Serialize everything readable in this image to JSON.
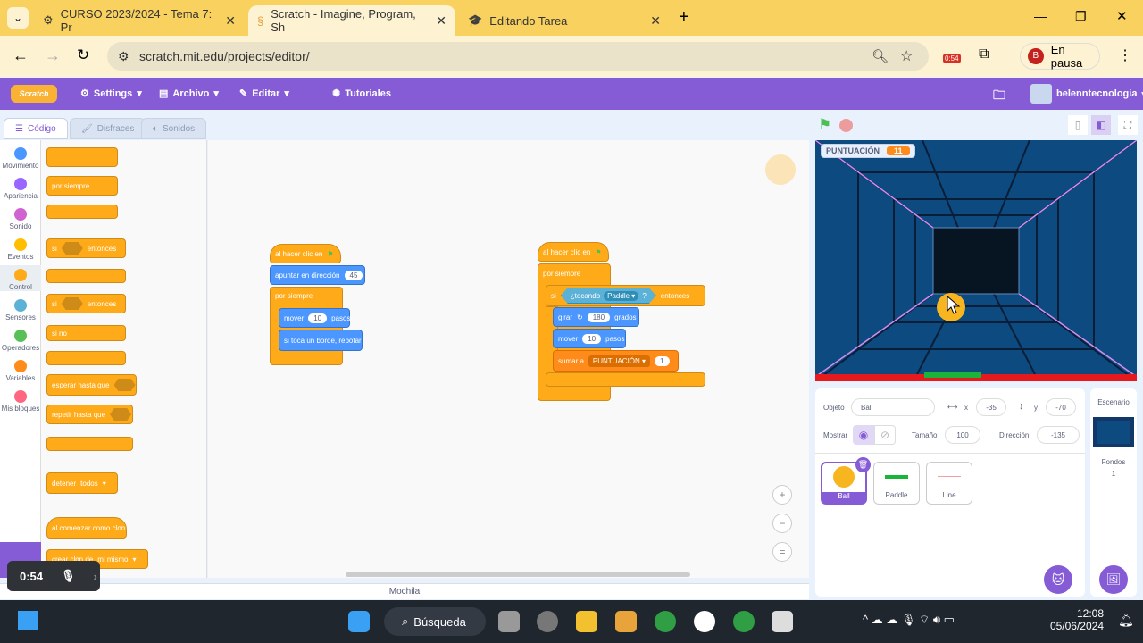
{
  "browser": {
    "tabs": [
      {
        "label": "CURSO 2023/2024 - Tema 7: Pr"
      },
      {
        "label": "Scratch - Imagine, Program, Sh"
      },
      {
        "label": "Editando Tarea"
      }
    ],
    "url": "scratch.mit.edu/projects/editor/",
    "timer_badge": "0:54",
    "profile_initial": "B",
    "profile_label": "En pausa"
  },
  "menubar": {
    "logo": "Scratch",
    "settings": "Settings",
    "file": "Archivo",
    "edit": "Editar",
    "tutorials": "Tutoriales",
    "user": "belenntecnologia"
  },
  "editor_tabs": {
    "code": "Código",
    "costumes": "Disfraces",
    "sounds": "Sonidos"
  },
  "categories": [
    {
      "label": "Movimiento",
      "color": "#4c97ff"
    },
    {
      "label": "Apariencia",
      "color": "#9966ff"
    },
    {
      "label": "Sonido",
      "color": "#cf63cf"
    },
    {
      "label": "Eventos",
      "color": "#ffbf00"
    },
    {
      "label": "Control",
      "color": "#ffab19"
    },
    {
      "label": "Sensores",
      "color": "#5cb1d6"
    },
    {
      "label": "Operadores",
      "color": "#59c059"
    },
    {
      "label": "Variables",
      "color": "#ff8c1a"
    },
    {
      "label": "Mis bloques",
      "color": "#ff6680"
    }
  ],
  "palette": {
    "forever": "por siempre",
    "if": "si",
    "then": "entonces",
    "else": "si no",
    "wait_until": "esperar hasta que",
    "repeat_until": "repetir hasta que",
    "stop": "detener",
    "stop_opt": "todos",
    "when_clone": "al comenzar como clon",
    "create_clone": "crear clon de",
    "clone_opt": "mi mismo"
  },
  "script1": {
    "hat": "al hacer clic en",
    "point": "apuntar en dirección",
    "point_val": "45",
    "forever": "por siempre",
    "move": "mover",
    "move_val": "10",
    "steps": "pasos",
    "bounce": "si toca un borde, rebotar"
  },
  "script2": {
    "hat": "al hacer clic en",
    "forever": "por siempre",
    "if": "si",
    "touching": "¿tocando",
    "touch_obj": "Paddle",
    "q": "?",
    "then": "entonces",
    "turn": "girar",
    "turn_val": "180",
    "degrees": "grados",
    "move": "mover",
    "move_val": "10",
    "steps": "pasos",
    "change": "sumar a",
    "var": "PUNTUACIÓN",
    "change_val": "1"
  },
  "backpack": "Mochila",
  "recorder": {
    "time": "0:54"
  },
  "stage": {
    "monitor_label": "PUNTUACIÓN",
    "monitor_value": "11"
  },
  "sprite_info": {
    "sprite_label": "Objeto",
    "sprite_name": "Ball",
    "x_label": "x",
    "x": "-35",
    "y_label": "y",
    "y": "-70",
    "show_label": "Mostrar",
    "size_label": "Tamaño",
    "size": "100",
    "direction_label": "Dirección",
    "direction": "-135"
  },
  "sprites": [
    {
      "name": "Ball",
      "selected": true
    },
    {
      "name": "Paddle"
    },
    {
      "name": "Line"
    }
  ],
  "backdrop": {
    "title": "Escenario",
    "label": "Fondos",
    "count": "1"
  },
  "taskbar": {
    "search": "Búsqueda",
    "time": "12:08",
    "date": "05/06/2024"
  }
}
